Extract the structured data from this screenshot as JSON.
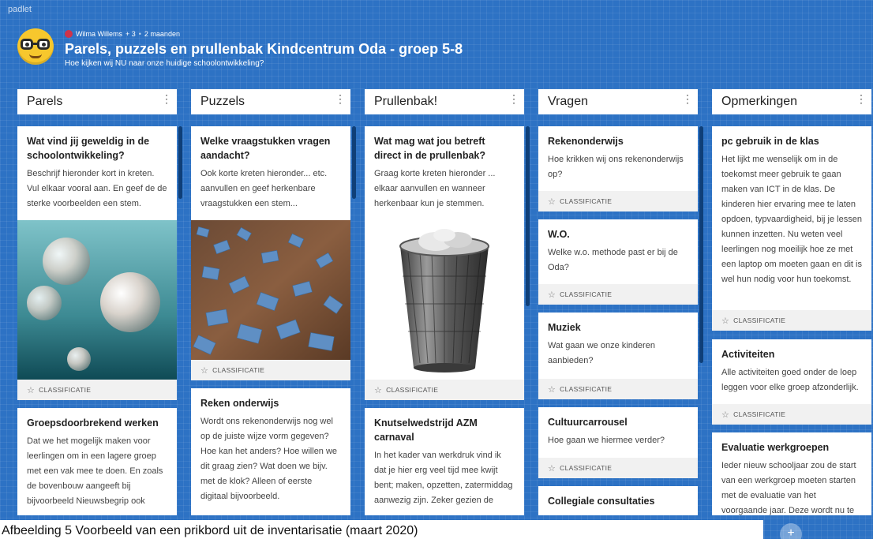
{
  "app": {
    "brand": "padlet"
  },
  "header": {
    "author": "Wilma Willems",
    "contributors": "+ 3",
    "age": "2 maanden",
    "title": "Parels, puzzels en prullenbak Kindcentrum Oda - groep 5-8",
    "subtitle": "Hoe kijken wij NU naar onze huidige schoolontwikkeling?"
  },
  "tag": "CLASSIFICATIE",
  "columns": [
    {
      "header": "Parels",
      "cards": [
        {
          "title": "Wat vind jij geweldig in de schoolontwikkeling?",
          "body": "Beschrijf hieronder kort in kreten. Vul elkaar vooral aan. En geef de de sterke voorbeelden een stem."
        },
        {
          "title": "Groepsdoorbrekend werken",
          "body": "Dat we het mogelijk maken voor leerlingen om in een lagere groep met een vak mee te doen. En zoals de bovenbouw aangeeft bij bijvoorbeeld Nieuwsbegrip ook"
        }
      ]
    },
    {
      "header": "Puzzels",
      "cards": [
        {
          "title": "Welke vraagstukken vragen aandacht?",
          "body": "Ook korte kreten hieronder... etc. aanvullen en geef herkenbare vraagstukken een stem..."
        },
        {
          "title": "Reken onderwijs",
          "body": "Wordt ons rekenonderwijs nog wel op de juiste wijze vorm gegeven? Hoe kan het anders? Hoe willen we dit graag zien? Wat doen we bijv. met de klok? Alleen of eerste digitaal bijvoorbeeld."
        }
      ]
    },
    {
      "header": "Prullenbak!",
      "cards": [
        {
          "title": "Wat mag wat jou betreft direct in de prullenbak?",
          "body": "Graag korte kreten hieronder ... elkaar aanvullen en wanneer herkenbaar kun je stemmen."
        },
        {
          "title": "Knutselwedstrijd AZM carnaval",
          "body": "In het kader van werkdruk vind ik dat je hier erg veel tijd mee kwijt bent; maken, opzetten, zatermiddag aanwezig zijn. Zeker gezien de"
        }
      ]
    },
    {
      "header": "Vragen",
      "cards": [
        {
          "title": "Rekenonderwijs",
          "body": "Hoe krikken wij ons rekenonderwijs op?"
        },
        {
          "title": "W.O.",
          "body": "Welke w.o. methode past er bij de Oda?"
        },
        {
          "title": "Muziek",
          "body": "Wat gaan we onze kinderen aanbieden?"
        },
        {
          "title": "Cultuurcarrousel",
          "body": "Hoe gaan we hiermee verder?"
        },
        {
          "title": "Collegiale consultaties",
          "body": ""
        }
      ]
    },
    {
      "header": "Opmerkingen",
      "cards": [
        {
          "title": "pc gebruik in de klas",
          "body": "Het lijkt me wenselijk om in de toekomst meer gebruik te gaan maken van ICT in de klas. De kinderen hier ervaring mee te laten opdoen, typvaardigheid, bij je lessen kunnen inzetten. Nu weten veel leerlingen nog moeilijk hoe ze met een laptop om moeten gaan en dit is wel hun nodig voor hun toekomst."
        },
        {
          "title": "Activiteiten",
          "body": "Alle activiteiten goed onder de loep leggen voor elke groep afzonderlijk."
        },
        {
          "title": "Evaluatie werkgroepen",
          "body": "Ieder nieuw schooljaar zou de start van een werkgroep moeten starten met de evaluatie van het voorgaande jaar. Deze wordt nu te"
        }
      ]
    }
  ],
  "caption": "Afbeelding  5  Voorbeeld van een prikbord uit de inventarisatie (maart 2020)",
  "fab": "+"
}
